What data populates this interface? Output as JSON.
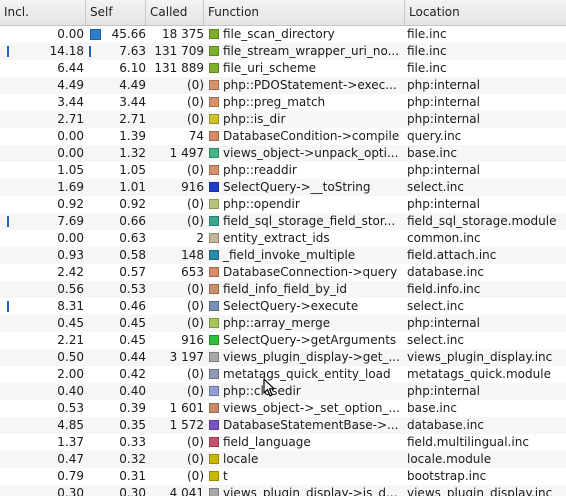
{
  "columns": {
    "incl": "Incl.",
    "self": "Self",
    "called": "Called",
    "function": "Function",
    "location": "Location"
  },
  "rows": [
    {
      "incl": "0.00",
      "self": "45.66",
      "called": "18 375",
      "function": "file_scan_directory",
      "location": "file.inc",
      "color": "#7fae2e",
      "incl_bar": false,
      "self_bar": "big"
    },
    {
      "incl": "14.18",
      "self": "7.63",
      "called": "131 709",
      "function": "file_stream_wrapper_uri_no...",
      "location": "file.inc",
      "color": "#7fae2e",
      "incl_bar": true,
      "self_bar": "thin"
    },
    {
      "incl": "6.44",
      "self": "6.10",
      "called": "131 889",
      "function": "file_uri_scheme",
      "location": "file.inc",
      "color": "#7fae2e",
      "incl_bar": false,
      "self_bar": "none"
    },
    {
      "incl": "4.49",
      "self": "4.49",
      "called": "(0)",
      "function": "php::PDOStatement->exec...",
      "location": "php:internal",
      "color": "#d4926a",
      "incl_bar": false,
      "self_bar": "none"
    },
    {
      "incl": "3.44",
      "self": "3.44",
      "called": "(0)",
      "function": "php::preg_match",
      "location": "php:internal",
      "color": "#d4926a",
      "incl_bar": false,
      "self_bar": "none"
    },
    {
      "incl": "2.71",
      "self": "2.71",
      "called": "(0)",
      "function": "php::is_dir",
      "location": "php:internal",
      "color": "#c9c428",
      "incl_bar": false,
      "self_bar": "none"
    },
    {
      "incl": "0.00",
      "self": "1.39",
      "called": "74",
      "function": "DatabaseCondition->compile",
      "location": "query.inc",
      "color": "#d38b6a",
      "incl_bar": false,
      "self_bar": "none"
    },
    {
      "incl": "0.00",
      "self": "1.32",
      "called": "1 497",
      "function": "views_object->unpack_opti...",
      "location": "base.inc",
      "color": "#3fb886",
      "incl_bar": false,
      "self_bar": "none"
    },
    {
      "incl": "1.05",
      "self": "1.05",
      "called": "(0)",
      "function": "php::readdir",
      "location": "php:internal",
      "color": "#d4926a",
      "incl_bar": false,
      "self_bar": "none"
    },
    {
      "incl": "1.69",
      "self": "1.01",
      "called": "916",
      "function": "SelectQuery->__toString",
      "location": "select.inc",
      "color": "#1f3fc8",
      "incl_bar": false,
      "self_bar": "none"
    },
    {
      "incl": "0.92",
      "self": "0.92",
      "called": "(0)",
      "function": "php::opendir",
      "location": "php:internal",
      "color": "#b9c47a",
      "incl_bar": false,
      "self_bar": "none"
    },
    {
      "incl": "7.69",
      "self": "0.66",
      "called": "(0)",
      "function": "field_sql_storage_field_stor...",
      "location": "field_sql_storage.module",
      "color": "#3aa68e",
      "incl_bar": true,
      "self_bar": "none"
    },
    {
      "incl": "0.00",
      "self": "0.63",
      "called": "2",
      "function": "entity_extract_ids",
      "location": "common.inc",
      "color": "#c6b49a",
      "incl_bar": false,
      "self_bar": "none"
    },
    {
      "incl": "0.93",
      "self": "0.58",
      "called": "148",
      "function": "_field_invoke_multiple",
      "location": "field.attach.inc",
      "color": "#2a8aa8",
      "incl_bar": false,
      "self_bar": "none"
    },
    {
      "incl": "2.42",
      "self": "0.57",
      "called": "653",
      "function": "DatabaseConnection->query",
      "location": "database.inc",
      "color": "#d98a6a",
      "incl_bar": false,
      "self_bar": "none"
    },
    {
      "incl": "0.56",
      "self": "0.53",
      "called": "(0)",
      "function": "field_info_field_by_id",
      "location": "field.info.inc",
      "color": "#c98f6e",
      "incl_bar": false,
      "self_bar": "none"
    },
    {
      "incl": "8.31",
      "self": "0.46",
      "called": "(0)",
      "function": "SelectQuery->execute",
      "location": "select.inc",
      "color": "#7c8fb8",
      "incl_bar": true,
      "self_bar": "none"
    },
    {
      "incl": "0.45",
      "self": "0.45",
      "called": "(0)",
      "function": "php::array_merge",
      "location": "php:internal",
      "color": "#a8c45a",
      "incl_bar": false,
      "self_bar": "none"
    },
    {
      "incl": "2.21",
      "self": "0.45",
      "called": "916",
      "function": "SelectQuery->getArguments",
      "location": "select.inc",
      "color": "#2fbf3a",
      "incl_bar": false,
      "self_bar": "none"
    },
    {
      "incl": "0.50",
      "self": "0.44",
      "called": "3 197",
      "function": "views_plugin_display->get_...",
      "location": "views_plugin_display.inc",
      "color": "#a8a8a8",
      "incl_bar": false,
      "self_bar": "none"
    },
    {
      "incl": "2.00",
      "self": "0.42",
      "called": "(0)",
      "function": "metatags_quick_entity_load",
      "location": "metatags_quick.module",
      "color": "#8f9bb6",
      "incl_bar": false,
      "self_bar": "none"
    },
    {
      "incl": "0.40",
      "self": "0.40",
      "called": "(0)",
      "function": "php::closedir",
      "location": "php:internal",
      "color": "#8e9fd0",
      "incl_bar": false,
      "self_bar": "none"
    },
    {
      "incl": "0.53",
      "self": "0.39",
      "called": "1 601",
      "function": "views_object->_set_option_...",
      "location": "base.inc",
      "color": "#c8886a",
      "incl_bar": false,
      "self_bar": "none"
    },
    {
      "incl": "4.85",
      "self": "0.35",
      "called": "1 572",
      "function": "DatabaseStatementBase->...",
      "location": "database.inc",
      "color": "#7a52c8",
      "incl_bar": false,
      "self_bar": "none"
    },
    {
      "incl": "1.37",
      "self": "0.33",
      "called": "(0)",
      "function": "field_language",
      "location": "field.multilingual.inc",
      "color": "#c4506a",
      "incl_bar": false,
      "self_bar": "none"
    },
    {
      "incl": "0.47",
      "self": "0.32",
      "called": "(0)",
      "function": "locale",
      "location": "locale.module",
      "color": "#c8b800",
      "incl_bar": false,
      "self_bar": "none"
    },
    {
      "incl": "0.79",
      "self": "0.31",
      "called": "(0)",
      "function": "t",
      "location": "bootstrap.inc",
      "color": "#c8b800",
      "incl_bar": false,
      "self_bar": "none"
    },
    {
      "incl": "0.30",
      "self": "0.30",
      "called": "4 041",
      "function": "views_plugin_display->is_d...",
      "location": "views_plugin_display.inc",
      "color": "#a8a8a8",
      "incl_bar": false,
      "self_bar": "none"
    }
  ]
}
